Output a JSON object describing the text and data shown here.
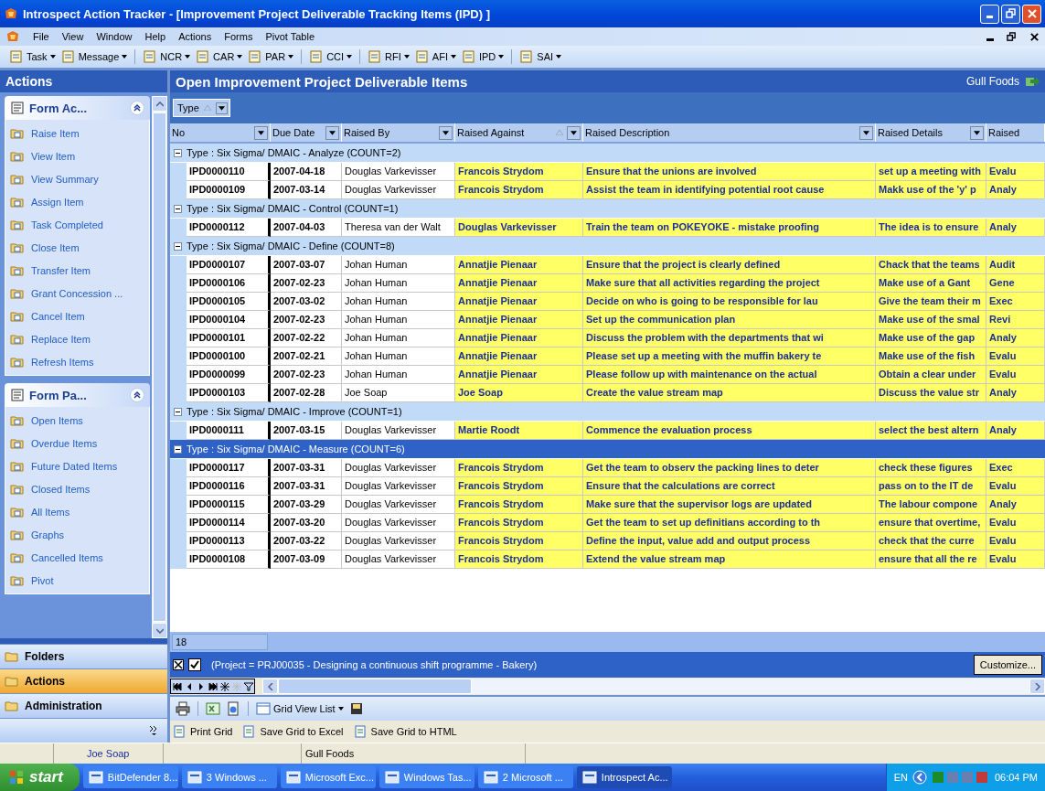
{
  "window": {
    "title": "Introspect Action Tracker - [Improvement Project Deliverable Tracking Items (IPD) ]"
  },
  "menu": [
    "File",
    "View",
    "Window",
    "Help",
    "Actions",
    "Forms",
    "Pivot Table"
  ],
  "toolbar": [
    "Task",
    "Message",
    "NCR",
    "CAR",
    "PAR",
    "CCI",
    "RFI",
    "AFI",
    "IPD",
    "SAI"
  ],
  "sidebar": {
    "title": "Actions",
    "panels": [
      {
        "title": "Form Ac...",
        "expanded": true,
        "items": [
          "Raise Item",
          "View Item",
          "View Summary",
          "Assign Item",
          "Task Completed",
          "Close Item",
          "Transfer Item",
          "Grant Concession ...",
          "Cancel Item",
          "Replace Item",
          "Refresh Items"
        ]
      },
      {
        "title": "Form Pa...",
        "expanded": true,
        "items": [
          "Open Items",
          "Overdue Items",
          "Future Dated Items",
          "Closed Items",
          "All Items",
          "Graphs",
          "Cancelled Items",
          "Pivot"
        ]
      }
    ],
    "nav": [
      {
        "label": "Folders",
        "selected": false
      },
      {
        "label": "Actions",
        "selected": true
      },
      {
        "label": "Administration",
        "selected": false
      }
    ]
  },
  "content": {
    "title": "Open Improvement Project Deliverable Items",
    "company": "Gull Foods",
    "group_by": "Type",
    "columns": [
      "No",
      "Due Date",
      "Raised By",
      "Raised Against",
      "Raised Description",
      "Raised Details",
      "Raised"
    ],
    "groups": [
      {
        "label": "Type : Six Sigma/ DMAIC - Analyze (COUNT=2)",
        "selected": false,
        "expanded": true,
        "rows": [
          [
            "IPD0000110",
            "2007-04-18",
            "Douglas Varkevisser",
            "Francois Strydom",
            "Ensure that the unions are involved",
            "set up a meeting with",
            "Evalu"
          ],
          [
            "IPD0000109",
            "2007-03-14",
            "Douglas Varkevisser",
            "Francois Strydom",
            "Assist the team in identifying potential root cause",
            "Makk use of the 'y' p",
            "Analy"
          ]
        ]
      },
      {
        "label": "Type : Six Sigma/ DMAIC - Control (COUNT=1)",
        "selected": false,
        "expanded": true,
        "rows": [
          [
            "IPD0000112",
            "2007-04-03",
            "Theresa van der Walt",
            "Douglas Varkevisser",
            "Train the team on POKEYOKE - mistake proofing",
            "The idea is to ensure",
            "Analy"
          ]
        ]
      },
      {
        "label": "Type : Six Sigma/ DMAIC - Define (COUNT=8)",
        "selected": false,
        "expanded": true,
        "rows": [
          [
            "IPD0000107",
            "2007-03-07",
            "Johan Human",
            "Annatjie Pienaar",
            "Ensure that the project is clearly defined",
            "Chack that the teams",
            "Audit"
          ],
          [
            "IPD0000106",
            "2007-02-23",
            "Johan Human",
            "Annatjie Pienaar",
            "Make sure that all activities regarding the project",
            "Make use of a Gant",
            "Gene"
          ],
          [
            "IPD0000105",
            "2007-03-02",
            "Johan Human",
            "Annatjie Pienaar",
            "Decide on who is going to be responsible for lau",
            "Give the team their m",
            "Exec"
          ],
          [
            "IPD0000104",
            "2007-02-23",
            "Johan Human",
            "Annatjie Pienaar",
            "Set up the communication plan",
            "Make use of the smal",
            "Revi"
          ],
          [
            "IPD0000101",
            "2007-02-22",
            "Johan Human",
            "Annatjie Pienaar",
            "Discuss the problem with the departments that wi",
            "Make use of the gap",
            "Analy"
          ],
          [
            "IPD0000100",
            "2007-02-21",
            "Johan Human",
            "Annatjie Pienaar",
            "Please set up a meeting with the muffin bakery te",
            "Make use of the fish",
            "Evalu"
          ],
          [
            "IPD0000099",
            "2007-02-23",
            "Johan Human",
            "Annatjie Pienaar",
            "Please follow up with maintenance on the actual",
            "Obtain a clear under",
            "Evalu"
          ],
          [
            "IPD0000103",
            "2007-02-28",
            "Joe Soap",
            "Joe Soap",
            "Create the value stream map",
            "Discuss the value str",
            "Analy"
          ]
        ]
      },
      {
        "label": "Type : Six Sigma/ DMAIC - Improve (COUNT=1)",
        "selected": false,
        "expanded": true,
        "rows": [
          [
            "IPD0000111",
            "2007-03-15",
            "Douglas Varkevisser",
            "Martie Roodt",
            "Commence the evaluation process",
            "select the best altern",
            "Analy"
          ]
        ]
      },
      {
        "label": "Type : Six Sigma/ DMAIC - Measure (COUNT=6)",
        "selected": true,
        "expanded": true,
        "rows": [
          [
            "IPD0000117",
            "2007-03-31",
            "Douglas Varkevisser",
            "Francois Strydom",
            "Get the team to observ the packing lines to deter",
            "check these figures",
            "Exec"
          ],
          [
            "IPD0000116",
            "2007-03-31",
            "Douglas Varkevisser",
            "Francois Strydom",
            "Ensure that the calculations are correct",
            "pass on to the IT de",
            "Evalu"
          ],
          [
            "IPD0000115",
            "2007-03-29",
            "Douglas Varkevisser",
            "Francois Strydom",
            "Make sure that the supervisor logs are updated",
            "The labour compone",
            "Analy"
          ],
          [
            "IPD0000114",
            "2007-03-20",
            "Douglas Varkevisser",
            "Francois Strydom",
            "Get the team to set up definitians according to th",
            "ensure that overtime,",
            "Evalu"
          ],
          [
            "IPD0000113",
            "2007-03-22",
            "Douglas Varkevisser",
            "Francois Strydom",
            "Define the input, value add and output process",
            "check that the curre",
            "Evalu"
          ],
          [
            "IPD0000108",
            "2007-03-09",
            "Douglas Varkevisser",
            "Francois Strydom",
            "Extend the value stream map",
            "ensure that all the re",
            "Evalu"
          ]
        ]
      }
    ],
    "count": "18",
    "filter": {
      "enabled": true,
      "text": "(Project = PRJ00035 - Designing a continuous shift programme - Bakery)"
    },
    "customize": "Customize..."
  },
  "grid_toolbar": {
    "view": "Grid View List"
  },
  "print_bar": [
    "Print Grid",
    "Save Grid to Excel",
    "Save Grid to HTML"
  ],
  "status_bar": [
    "Joe Soap",
    "Gull Foods"
  ],
  "taskbar": {
    "start": "start",
    "tasks": [
      {
        "label": "BitDefender 8...",
        "selected": false
      },
      {
        "label": "3 Windows ...",
        "selected": false
      },
      {
        "label": "Microsoft Exc...",
        "selected": false
      },
      {
        "label": "Windows Tas...",
        "selected": false
      },
      {
        "label": "2 Microsoft ...",
        "selected": false
      },
      {
        "label": "Introspect Ac...",
        "selected": true
      }
    ],
    "language": "EN",
    "clock": "06:04 PM"
  }
}
